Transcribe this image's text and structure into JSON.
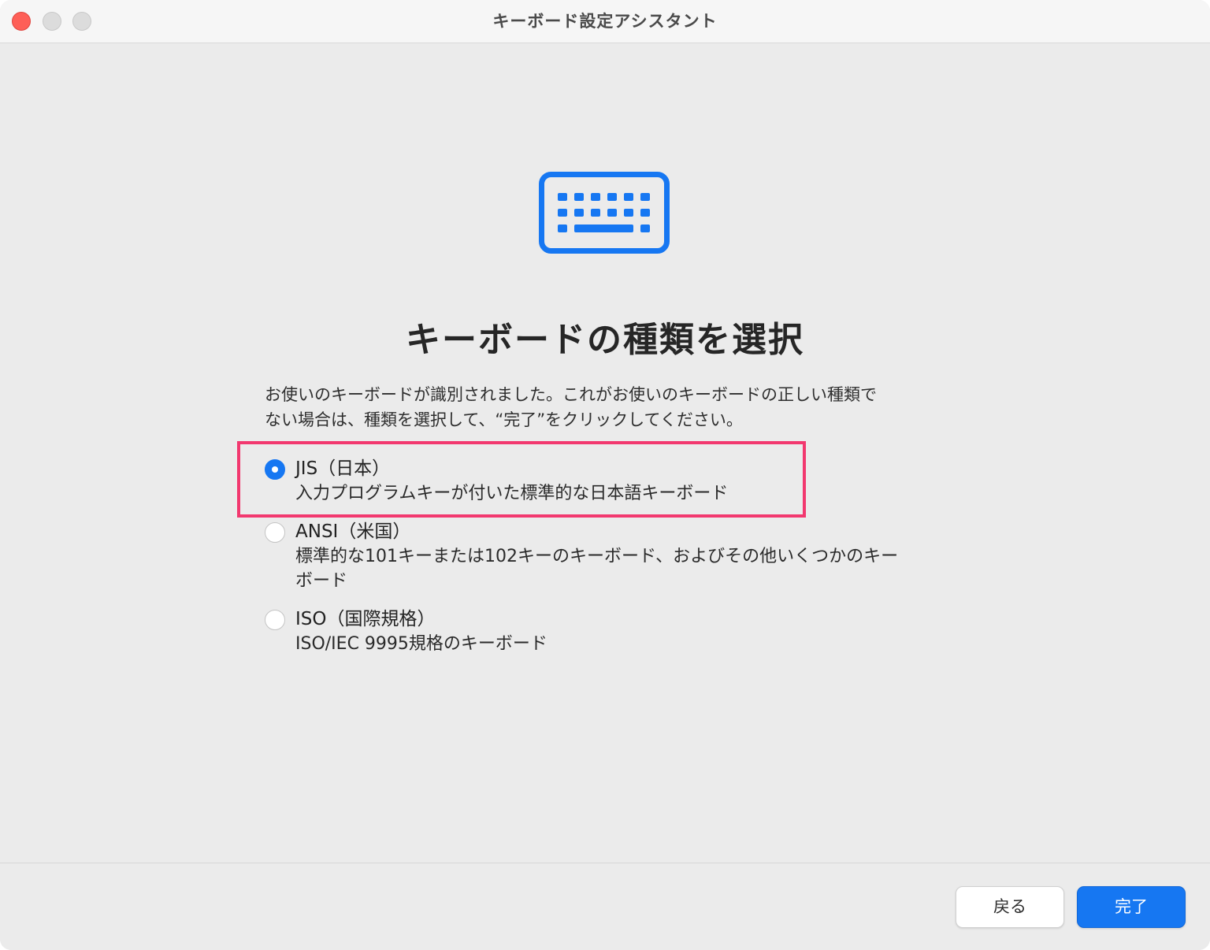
{
  "window": {
    "title": "キーボード設定アシスタント"
  },
  "main": {
    "icon": "keyboard-icon",
    "accent_color": "#1677f2",
    "heading": "キーボードの種類を選択",
    "description_lines": [
      "お使いのキーボードが識別されました。これがお使いのキーボードの正しい種類で",
      "ない場合は、種類を選択して、“完了”をクリックしてください。"
    ],
    "options": [
      {
        "title": "JIS（日本）",
        "description": "入力プログラムキーが付いた標準的な日本語キーボード",
        "selected": true
      },
      {
        "title": "ANSI（米国）",
        "description": "標準的な101キーまたは102キーのキーボード、およびその他いくつかのキーボード",
        "selected": false
      },
      {
        "title": "ISO（国際規格）",
        "description": "ISO/IEC 9995規格のキーボード",
        "selected": false
      }
    ],
    "highlight_color": "#f2386f"
  },
  "footer": {
    "back_label": "戻る",
    "done_label": "完了"
  }
}
